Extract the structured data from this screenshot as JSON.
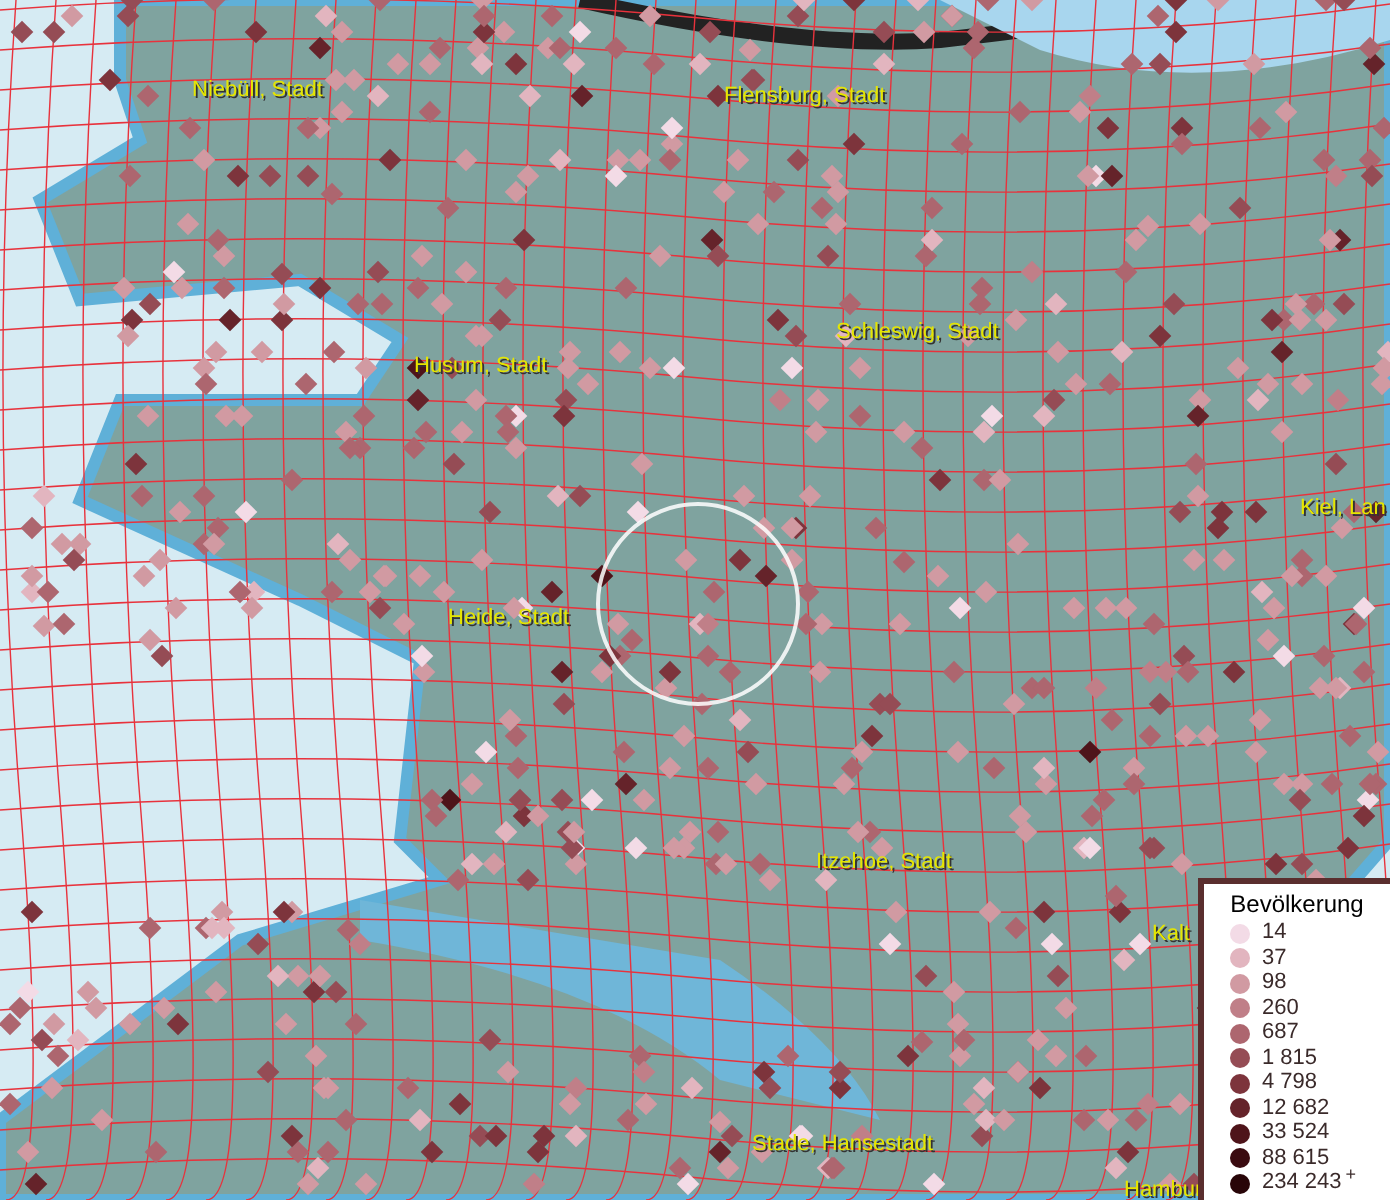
{
  "map": {
    "place_labels": [
      "Niebüll, Stadt",
      "Flensburg, Stadt",
      "Husum, Stadt",
      "Schleswig, Stadt",
      "Kiel, Lan",
      "Heide, Stadt",
      "Itzehoe, Stadt",
      "Kalt",
      "Stade, Hansestadt",
      "Hambur"
    ]
  },
  "legend": {
    "title": "Bevölkerung",
    "items": [
      {
        "label": "14",
        "color": "#f3dbe6"
      },
      {
        "label": "37",
        "color": "#e2b5bf"
      },
      {
        "label": "98",
        "color": "#d19aa2"
      },
      {
        "label": "260",
        "color": "#c07f88"
      },
      {
        "label": "687",
        "color": "#ad666f"
      },
      {
        "label": "1 815",
        "color": "#954c55"
      },
      {
        "label": "4 798",
        "color": "#7d343c"
      },
      {
        "label": "12 682",
        "color": "#65232a"
      },
      {
        "label": "33 524",
        "color": "#4e141a"
      },
      {
        "label": "88 615",
        "color": "#3a0b10"
      },
      {
        "label": "234 243",
        "color": "#280508",
        "suffix": "+"
      }
    ]
  }
}
